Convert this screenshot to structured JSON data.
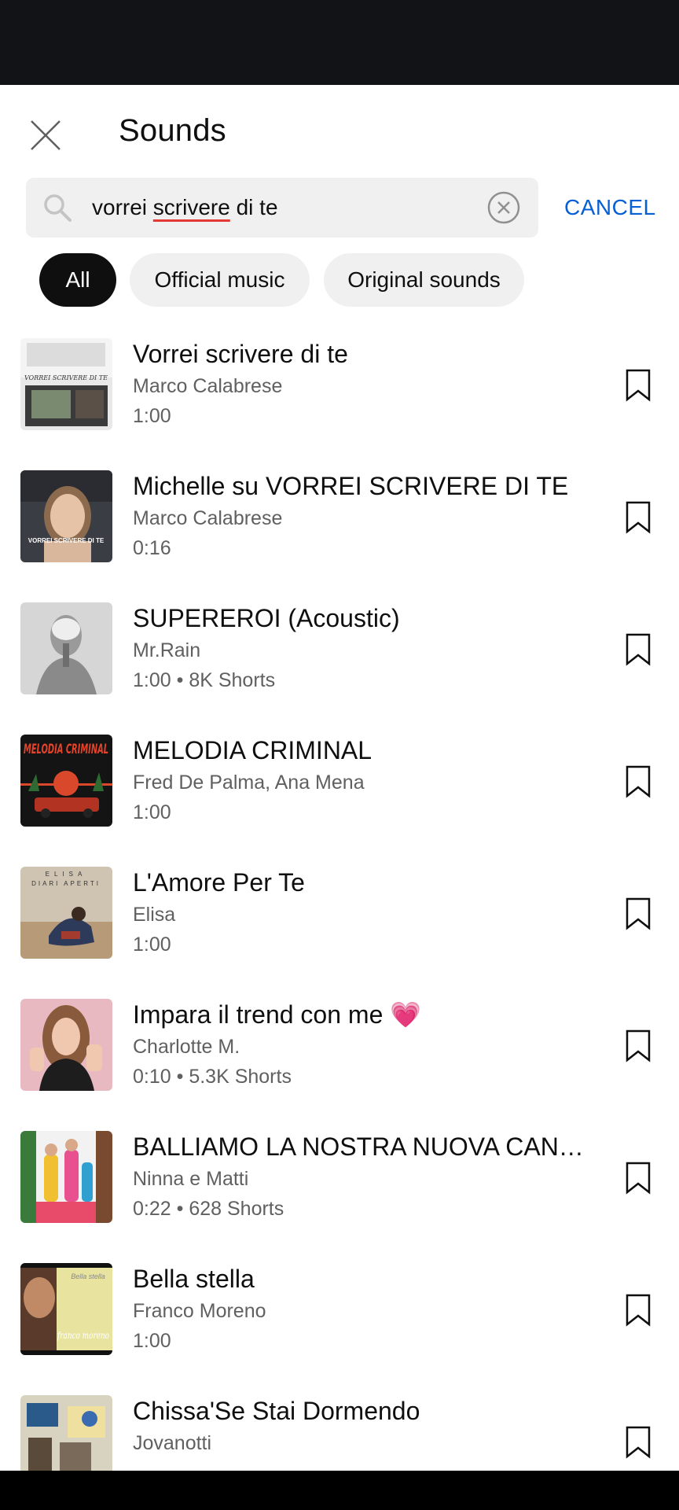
{
  "header": {
    "title": "Sounds"
  },
  "search": {
    "query_before": "vorrei ",
    "query_misspelled": "scrivere",
    "query_after": " di te",
    "cancel_label": "CANCEL"
  },
  "filters": [
    {
      "label": "All",
      "active": true
    },
    {
      "label": "Official music",
      "active": false
    },
    {
      "label": "Original sounds",
      "active": false
    }
  ],
  "sounds": [
    {
      "title": "Vorrei scrivere di te",
      "artist": "Marco Calabrese",
      "duration": "1:00",
      "shorts": ""
    },
    {
      "title": "Michelle su VORREI SCRIVERE DI TE",
      "artist": "Marco Calabrese",
      "duration": "0:16",
      "shorts": ""
    },
    {
      "title": "SUPEREROI (Acoustic)",
      "artist": "Mr.Rain",
      "duration": "1:00",
      "shorts": "8K Shorts"
    },
    {
      "title": "MELODIA CRIMINAL",
      "artist": "Fred De Palma, Ana Mena",
      "duration": "1:00",
      "shorts": ""
    },
    {
      "title": "L'Amore Per Te",
      "artist": "Elisa",
      "duration": "1:00",
      "shorts": ""
    },
    {
      "title": "Impara il trend con me 💗",
      "artist": "Charlotte M.",
      "duration": "0:10",
      "shorts": "5.3K Shorts"
    },
    {
      "title": "BALLIAMO LA NOSTRA NUOVA CANZONE",
      "artist": "Ninna e Matti",
      "duration": "0:22",
      "shorts": "628 Shorts"
    },
    {
      "title": "Bella stella",
      "artist": "Franco Moreno",
      "duration": "1:00",
      "shorts": ""
    },
    {
      "title": "Chissa'Se Stai Dormendo",
      "artist": "Jovanotti",
      "duration": "",
      "shorts": ""
    }
  ],
  "thumbnail_text": {
    "t1": "VORREI SCRIVERE DI TE",
    "t2": "VORREI SCRIVERE DI TE",
    "t4": "MELODIA CRIMINAL",
    "t5a": "ELISA",
    "t5b": "DIARI APERTI",
    "t8a": "Bella stella",
    "t8b": "franco moreno"
  },
  "colors": {
    "accent": "#065fd4",
    "text": "#0f0f0f",
    "secondary": "#606060",
    "chip_bg": "#f0f0f0"
  },
  "icons": {
    "close": "close-icon",
    "search": "search-icon",
    "clear": "clear-icon",
    "bookmark": "bookmark-icon"
  }
}
